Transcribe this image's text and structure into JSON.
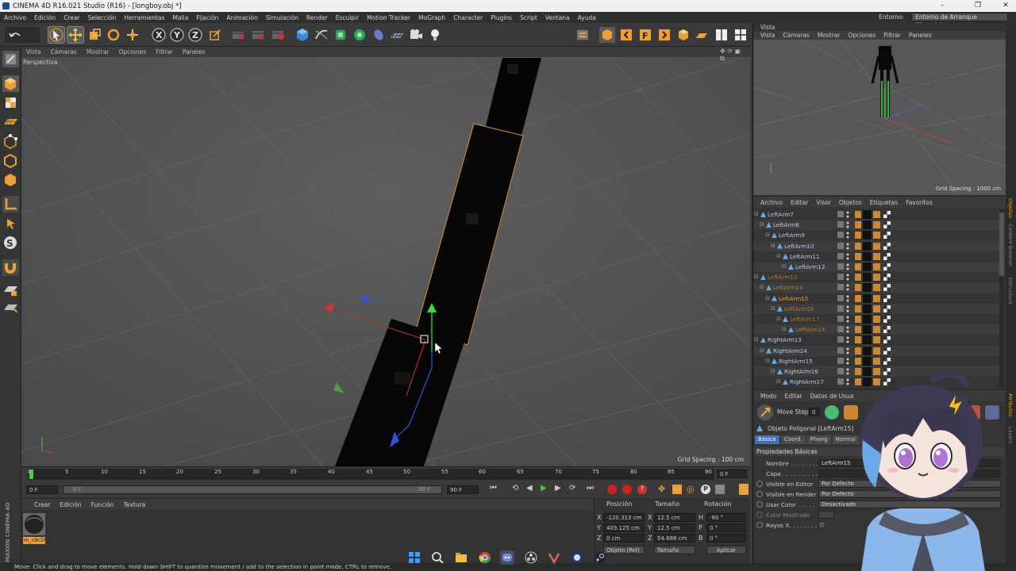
{
  "window": {
    "title": "CINEMA 4D R16.021 Studio (R16) - [longboy.obj *]",
    "minimize": "–",
    "maximize": "❐",
    "close": "✕"
  },
  "menubar": {
    "items": [
      "Archivo",
      "Edición",
      "Crear",
      "Selección",
      "Herramientas",
      "Malla",
      "Fijación",
      "Animación",
      "Simulación",
      "Render",
      "Esculpir",
      "Motion Tracker",
      "MoGraph",
      "Character",
      "Plugins",
      "Script",
      "Ventana",
      "Ayuda"
    ],
    "entorno_label": "Entorno:",
    "entorno_value": "Entorno de Arranque (Usuario)"
  },
  "viewport": {
    "menu": [
      "Vista",
      "Cámaras",
      "Mostrar",
      "Opciones",
      "Filtrar",
      "Paneles"
    ],
    "label": "Perspectiva",
    "grid_spacing": "Grid Spacing : 100 cm"
  },
  "timeline": {
    "ticks": [
      "0",
      "5",
      "10",
      "15",
      "20",
      "25",
      "30",
      "35",
      "40",
      "45",
      "50",
      "55",
      "60",
      "65",
      "70",
      "75",
      "80",
      "85",
      "90"
    ],
    "current_frame": "0 F",
    "start_field": "0 F",
    "min_field": "0 F",
    "max_field": "90 F",
    "end_field": "90 F"
  },
  "material_manager": {
    "menu": [
      "Crear",
      "Edición",
      "Función",
      "Textura"
    ],
    "material_name": "m_c9c5f",
    "brand": "MAXON CINEMA 4D"
  },
  "coordinates": {
    "headers": [
      "Posición",
      "Tamaño",
      "Rotación"
    ],
    "rows": [
      {
        "axis": "X",
        "pos": "-120.313 cm",
        "size_axis": "X",
        "size": "12.5 cm",
        "rot_axis": "H",
        "rot": "-90 °"
      },
      {
        "axis": "Y",
        "pos": "403.125 cm",
        "size_axis": "Y",
        "size": "12.5 cm",
        "rot_axis": "P",
        "rot": "0 °"
      },
      {
        "axis": "Z",
        "pos": "0 cm",
        "size_axis": "Z",
        "size": "54.688 cm",
        "rot_axis": "B",
        "rot": "0 °"
      }
    ],
    "mode_dropdown": "Objeto (Rel)",
    "size_dropdown": "Tamaño",
    "apply_button": "Aplicar"
  },
  "status": "Move: Click and drag to move elements. Hold down SHIFT to quantize movement / add to the selection in point mode, CTRL to remove.",
  "vista_panel": {
    "title": "Vista",
    "menu": [
      "Vista",
      "Cámaras",
      "Mostrar",
      "Opciones",
      "Filtrar",
      "Paneles"
    ],
    "grid_spacing": "Grid Spacing : 1000 cm"
  },
  "object_manager": {
    "menu": [
      "Archivo",
      "Editar",
      "Visor",
      "Objetos",
      "Etiquetas",
      "Favoritos"
    ],
    "objects": [
      {
        "name": "LeftArm7",
        "level": 0,
        "state": "normal"
      },
      {
        "name": "LeftArm8",
        "level": 1,
        "state": "normal"
      },
      {
        "name": "LeftArm9",
        "level": 2,
        "state": "normal"
      },
      {
        "name": "LeftArm10",
        "level": 3,
        "state": "normal"
      },
      {
        "name": "LeftArm11",
        "level": 4,
        "state": "normal"
      },
      {
        "name": "LeftArm12",
        "level": 5,
        "state": "normal"
      },
      {
        "name": "LeftArm13",
        "level": 0,
        "state": "orange-dim"
      },
      {
        "name": "LeftArm14",
        "level": 1,
        "state": "orange-dim"
      },
      {
        "name": "LeftArm15",
        "level": 2,
        "state": "selected"
      },
      {
        "name": "LeftArm16",
        "level": 3,
        "state": "orange-dim"
      },
      {
        "name": "LeftArm17",
        "level": 4,
        "state": "orange-dim"
      },
      {
        "name": "LeftArm18",
        "level": 5,
        "state": "orange-dim"
      },
      {
        "name": "RightArm13",
        "level": 0,
        "state": "normal"
      },
      {
        "name": "RightArm14",
        "level": 1,
        "state": "normal"
      },
      {
        "name": "RightArm15",
        "level": 2,
        "state": "normal"
      },
      {
        "name": "RightArm16",
        "level": 3,
        "state": "normal"
      },
      {
        "name": "RightArm17",
        "level": 4,
        "state": "normal"
      }
    ]
  },
  "attribute_manager": {
    "menu": [
      "Modo",
      "Editar",
      "Datos de Usua"
    ],
    "tool_label": "Move Step",
    "tool_value": "0",
    "object_title": "Objeto Poligonal [LeftArm15]",
    "tabs": [
      "Básico",
      "Coord.",
      "Phong",
      "Normal"
    ],
    "section": "Propiedades Básicas",
    "fields": [
      {
        "label": "Nombre . . . . . . . . .",
        "value": "LeftArm15"
      },
      {
        "label": "Capa . . . . . . . . . .",
        "value": ""
      },
      {
        "label": "Visible en Editor",
        "value": "Por Defecto"
      },
      {
        "label": "Visible en Render",
        "value": "Por Defecto"
      },
      {
        "label": "Usar Color . . . . .",
        "value": "Desactivado"
      },
      {
        "label": "Color Mostrado",
        "value": ""
      },
      {
        "label": "Rayos X. . . . . . . .",
        "value": ""
      }
    ]
  },
  "side_tabs": [
    "Objetos",
    "Content Browser",
    "Estructura",
    "Atributos",
    "Layers"
  ],
  "colors": {
    "accent_orange": "#f0a030",
    "select_blue": "#4a7fd0",
    "viewport_bg": "#545454"
  }
}
